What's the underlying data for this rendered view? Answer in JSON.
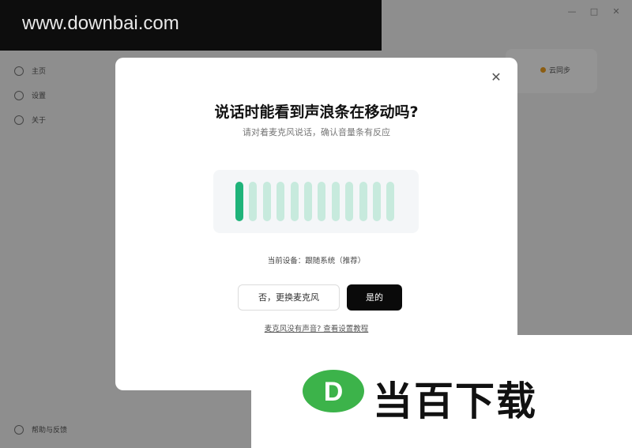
{
  "background": {
    "window_controls": [
      "—",
      "□",
      "✕"
    ],
    "nav_items": [
      {
        "label": "主页",
        "icon": "home-icon"
      },
      {
        "label": "设置",
        "icon": "settings-icon"
      },
      {
        "label": "关于",
        "icon": "info-icon"
      }
    ],
    "bottom_item": "帮助与反馈",
    "card_badge": "云同步"
  },
  "watermark": {
    "site": "www.downbai.com",
    "logo_letter": "D",
    "logo_text": "当百下载",
    "logo_color": "#3cb34a"
  },
  "dialog": {
    "title": "说话时能看到声浪条在移动吗?",
    "subtitle": "请对着麦克风说话，确认音量条有反应",
    "meter": {
      "total_bars": 12,
      "active_bars": 1,
      "active_color": "#1fb37a",
      "idle_color": "#c7eadd"
    },
    "device_text": "当前设备：跟随系统（推荐）",
    "no_button": "否，更换麦克风",
    "yes_button": "是的",
    "help_link": "麦克风没有声音? 查看设置教程"
  }
}
